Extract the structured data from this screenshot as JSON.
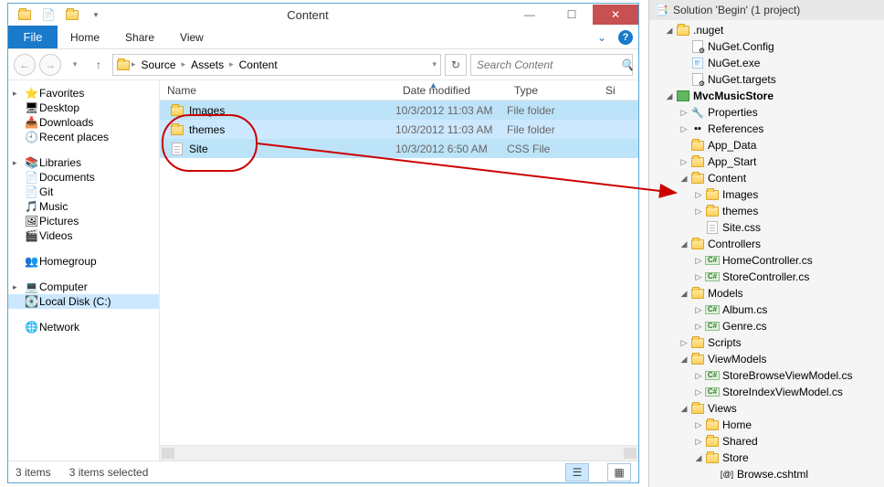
{
  "explorer": {
    "title": "Content",
    "ribbon": {
      "file": "File",
      "tabs": [
        "Home",
        "Share",
        "View"
      ]
    },
    "breadcrumb": [
      "Source",
      "Assets",
      "Content"
    ],
    "search": {
      "placeholder": "Search Content"
    },
    "sidebar": {
      "favorites": {
        "label": "Favorites",
        "items": [
          "Desktop",
          "Downloads",
          "Recent places"
        ]
      },
      "libraries": {
        "label": "Libraries",
        "items": [
          "Documents",
          "Git",
          "Music",
          "Pictures",
          "Videos"
        ]
      },
      "homegroup": {
        "label": "Homegroup"
      },
      "computer": {
        "label": "Computer",
        "items": [
          "Local Disk (C:)"
        ]
      },
      "network": {
        "label": "Network"
      }
    },
    "columns": {
      "name": "Name",
      "date": "Date modified",
      "type": "Type",
      "size": "Si"
    },
    "rows": [
      {
        "icon": "folder",
        "name": "Images",
        "date": "10/3/2012 11:03 AM",
        "type": "File folder",
        "sel": "hi"
      },
      {
        "icon": "folder",
        "name": "themes",
        "date": "10/3/2012 11:03 AM",
        "type": "File folder",
        "sel": "sel"
      },
      {
        "icon": "css",
        "name": "Site",
        "date": "10/3/2012 6:50 AM",
        "type": "CSS File",
        "sel": "hi"
      }
    ],
    "status": {
      "left": "3 items",
      "right": "3 items selected"
    }
  },
  "solution": {
    "title": "Solution 'Begin' (1 project)",
    "tree": [
      {
        "d": 1,
        "c": "open",
        "ic": "folder-dot",
        "t": ".nuget"
      },
      {
        "d": 2,
        "c": "none",
        "ic": "config",
        "t": "NuGet.Config"
      },
      {
        "d": 2,
        "c": "none",
        "ic": "exe",
        "t": "NuGet.exe"
      },
      {
        "d": 2,
        "c": "none",
        "ic": "config",
        "t": "NuGet.targets"
      },
      {
        "d": 1,
        "c": "open",
        "ic": "proj",
        "t": "MvcMusicStore",
        "bold": true
      },
      {
        "d": 2,
        "c": "closed",
        "ic": "wrench",
        "t": "Properties"
      },
      {
        "d": 2,
        "c": "closed",
        "ic": "ref",
        "t": "References"
      },
      {
        "d": 2,
        "c": "none",
        "ic": "folder",
        "t": "App_Data"
      },
      {
        "d": 2,
        "c": "closed",
        "ic": "folder",
        "t": "App_Start"
      },
      {
        "d": 2,
        "c": "open",
        "ic": "folder",
        "t": "Content"
      },
      {
        "d": 3,
        "c": "closed",
        "ic": "folder",
        "t": "Images"
      },
      {
        "d": 3,
        "c": "closed",
        "ic": "folder",
        "t": "themes"
      },
      {
        "d": 3,
        "c": "none",
        "ic": "css",
        "t": "Site.css"
      },
      {
        "d": 2,
        "c": "open",
        "ic": "folder",
        "t": "Controllers"
      },
      {
        "d": 3,
        "c": "closed",
        "ic": "cs",
        "t": "HomeController.cs"
      },
      {
        "d": 3,
        "c": "closed",
        "ic": "cs",
        "t": "StoreController.cs"
      },
      {
        "d": 2,
        "c": "open",
        "ic": "folder",
        "t": "Models"
      },
      {
        "d": 3,
        "c": "closed",
        "ic": "cs",
        "t": "Album.cs"
      },
      {
        "d": 3,
        "c": "closed",
        "ic": "cs",
        "t": "Genre.cs"
      },
      {
        "d": 2,
        "c": "closed",
        "ic": "folder",
        "t": "Scripts"
      },
      {
        "d": 2,
        "c": "open",
        "ic": "folder",
        "t": "ViewModels"
      },
      {
        "d": 3,
        "c": "closed",
        "ic": "cs",
        "t": "StoreBrowseViewModel.cs"
      },
      {
        "d": 3,
        "c": "closed",
        "ic": "cs",
        "t": "StoreIndexViewModel.cs"
      },
      {
        "d": 2,
        "c": "open",
        "ic": "folder",
        "t": "Views"
      },
      {
        "d": 3,
        "c": "closed",
        "ic": "folder",
        "t": "Home"
      },
      {
        "d": 3,
        "c": "closed",
        "ic": "folder",
        "t": "Shared"
      },
      {
        "d": 3,
        "c": "open",
        "ic": "folder",
        "t": "Store"
      },
      {
        "d": 4,
        "c": "none",
        "ic": "cshtml",
        "t": "Browse.cshtml"
      }
    ]
  }
}
